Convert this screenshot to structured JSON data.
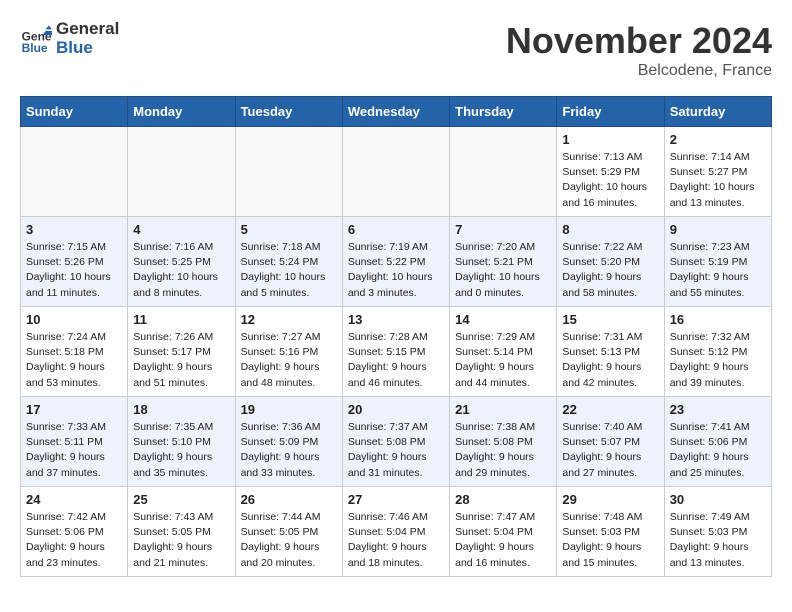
{
  "header": {
    "logo_line1": "General",
    "logo_line2": "Blue",
    "month_title": "November 2024",
    "location": "Belcodene, France"
  },
  "weekdays": [
    "Sunday",
    "Monday",
    "Tuesday",
    "Wednesday",
    "Thursday",
    "Friday",
    "Saturday"
  ],
  "weeks": [
    [
      {
        "day": "",
        "info": ""
      },
      {
        "day": "",
        "info": ""
      },
      {
        "day": "",
        "info": ""
      },
      {
        "day": "",
        "info": ""
      },
      {
        "day": "",
        "info": ""
      },
      {
        "day": "1",
        "info": "Sunrise: 7:13 AM\nSunset: 5:29 PM\nDaylight: 10 hours and 16 minutes."
      },
      {
        "day": "2",
        "info": "Sunrise: 7:14 AM\nSunset: 5:27 PM\nDaylight: 10 hours and 13 minutes."
      }
    ],
    [
      {
        "day": "3",
        "info": "Sunrise: 7:15 AM\nSunset: 5:26 PM\nDaylight: 10 hours and 11 minutes."
      },
      {
        "day": "4",
        "info": "Sunrise: 7:16 AM\nSunset: 5:25 PM\nDaylight: 10 hours and 8 minutes."
      },
      {
        "day": "5",
        "info": "Sunrise: 7:18 AM\nSunset: 5:24 PM\nDaylight: 10 hours and 5 minutes."
      },
      {
        "day": "6",
        "info": "Sunrise: 7:19 AM\nSunset: 5:22 PM\nDaylight: 10 hours and 3 minutes."
      },
      {
        "day": "7",
        "info": "Sunrise: 7:20 AM\nSunset: 5:21 PM\nDaylight: 10 hours and 0 minutes."
      },
      {
        "day": "8",
        "info": "Sunrise: 7:22 AM\nSunset: 5:20 PM\nDaylight: 9 hours and 58 minutes."
      },
      {
        "day": "9",
        "info": "Sunrise: 7:23 AM\nSunset: 5:19 PM\nDaylight: 9 hours and 55 minutes."
      }
    ],
    [
      {
        "day": "10",
        "info": "Sunrise: 7:24 AM\nSunset: 5:18 PM\nDaylight: 9 hours and 53 minutes."
      },
      {
        "day": "11",
        "info": "Sunrise: 7:26 AM\nSunset: 5:17 PM\nDaylight: 9 hours and 51 minutes."
      },
      {
        "day": "12",
        "info": "Sunrise: 7:27 AM\nSunset: 5:16 PM\nDaylight: 9 hours and 48 minutes."
      },
      {
        "day": "13",
        "info": "Sunrise: 7:28 AM\nSunset: 5:15 PM\nDaylight: 9 hours and 46 minutes."
      },
      {
        "day": "14",
        "info": "Sunrise: 7:29 AM\nSunset: 5:14 PM\nDaylight: 9 hours and 44 minutes."
      },
      {
        "day": "15",
        "info": "Sunrise: 7:31 AM\nSunset: 5:13 PM\nDaylight: 9 hours and 42 minutes."
      },
      {
        "day": "16",
        "info": "Sunrise: 7:32 AM\nSunset: 5:12 PM\nDaylight: 9 hours and 39 minutes."
      }
    ],
    [
      {
        "day": "17",
        "info": "Sunrise: 7:33 AM\nSunset: 5:11 PM\nDaylight: 9 hours and 37 minutes."
      },
      {
        "day": "18",
        "info": "Sunrise: 7:35 AM\nSunset: 5:10 PM\nDaylight: 9 hours and 35 minutes."
      },
      {
        "day": "19",
        "info": "Sunrise: 7:36 AM\nSunset: 5:09 PM\nDaylight: 9 hours and 33 minutes."
      },
      {
        "day": "20",
        "info": "Sunrise: 7:37 AM\nSunset: 5:08 PM\nDaylight: 9 hours and 31 minutes."
      },
      {
        "day": "21",
        "info": "Sunrise: 7:38 AM\nSunset: 5:08 PM\nDaylight: 9 hours and 29 minutes."
      },
      {
        "day": "22",
        "info": "Sunrise: 7:40 AM\nSunset: 5:07 PM\nDaylight: 9 hours and 27 minutes."
      },
      {
        "day": "23",
        "info": "Sunrise: 7:41 AM\nSunset: 5:06 PM\nDaylight: 9 hours and 25 minutes."
      }
    ],
    [
      {
        "day": "24",
        "info": "Sunrise: 7:42 AM\nSunset: 5:06 PM\nDaylight: 9 hours and 23 minutes."
      },
      {
        "day": "25",
        "info": "Sunrise: 7:43 AM\nSunset: 5:05 PM\nDaylight: 9 hours and 21 minutes."
      },
      {
        "day": "26",
        "info": "Sunrise: 7:44 AM\nSunset: 5:05 PM\nDaylight: 9 hours and 20 minutes."
      },
      {
        "day": "27",
        "info": "Sunrise: 7:46 AM\nSunset: 5:04 PM\nDaylight: 9 hours and 18 minutes."
      },
      {
        "day": "28",
        "info": "Sunrise: 7:47 AM\nSunset: 5:04 PM\nDaylight: 9 hours and 16 minutes."
      },
      {
        "day": "29",
        "info": "Sunrise: 7:48 AM\nSunset: 5:03 PM\nDaylight: 9 hours and 15 minutes."
      },
      {
        "day": "30",
        "info": "Sunrise: 7:49 AM\nSunset: 5:03 PM\nDaylight: 9 hours and 13 minutes."
      }
    ]
  ]
}
